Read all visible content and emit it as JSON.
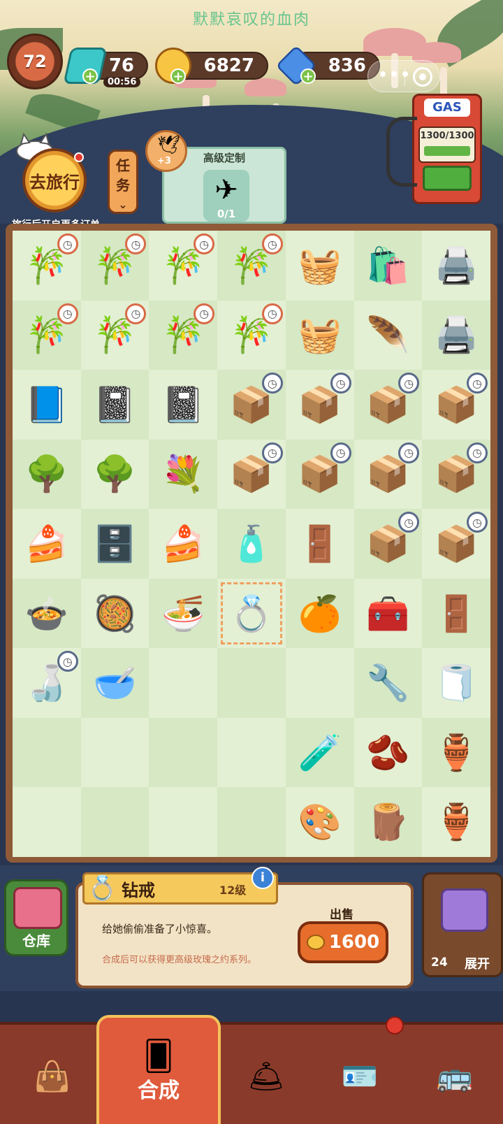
{
  "title": "默默哀叹的血肉",
  "level": "72",
  "resources": {
    "energy": {
      "value": "76",
      "timer": "00:56",
      "icon": "lightning-icon"
    },
    "coins": {
      "value": "6827",
      "icon": "paw-coin-icon"
    },
    "gems": {
      "value": "836",
      "icon": "gem-icon"
    }
  },
  "gas": {
    "sign": "GAS",
    "value": "1300/1300"
  },
  "travel": {
    "label": "去旅行",
    "tip": "旅行后开启更多订单"
  },
  "task": {
    "chars": [
      "任",
      "务"
    ]
  },
  "order": {
    "header": "高级定制",
    "count": "0/1",
    "badge": "+3"
  },
  "board": {
    "cells": [
      {
        "icon": "🎋",
        "clock": true
      },
      {
        "icon": "🎋",
        "clock": true
      },
      {
        "icon": "🎋",
        "clock": true
      },
      {
        "icon": "🎋",
        "clock": true
      },
      {
        "icon": "🧺",
        "clock": false
      },
      {
        "icon": "🛍️",
        "clock": false
      },
      {
        "icon": "🖨️",
        "clock": false
      },
      {
        "icon": "🎋",
        "clock": true
      },
      {
        "icon": "🎋",
        "clock": true
      },
      {
        "icon": "🎋",
        "clock": true
      },
      {
        "icon": "🎋",
        "clock": true
      },
      {
        "icon": "🧺",
        "clock": false
      },
      {
        "icon": "🪶",
        "clock": false
      },
      {
        "icon": "🖨️",
        "clock": false
      },
      {
        "icon": "📘",
        "clock": false
      },
      {
        "icon": "📓",
        "clock": false
      },
      {
        "icon": "📓",
        "clock": false
      },
      {
        "icon": "📦",
        "clock": true,
        "gray": true
      },
      {
        "icon": "📦",
        "clock": true,
        "gray": true
      },
      {
        "icon": "📦",
        "clock": true,
        "gray": true
      },
      {
        "icon": "📦",
        "clock": true,
        "gray": true
      },
      {
        "icon": "🌳",
        "clock": false
      },
      {
        "icon": "🌳",
        "clock": false
      },
      {
        "icon": "💐",
        "clock": false
      },
      {
        "icon": "📦",
        "clock": true,
        "gray": true
      },
      {
        "icon": "📦",
        "clock": true,
        "gray": true
      },
      {
        "icon": "📦",
        "clock": true,
        "gray": true
      },
      {
        "icon": "📦",
        "clock": true,
        "gray": true
      },
      {
        "icon": "🍰",
        "clock": false
      },
      {
        "icon": "🗄️",
        "clock": false
      },
      {
        "icon": "🍰",
        "clock": false
      },
      {
        "icon": "🧴",
        "clock": false
      },
      {
        "icon": "🚪",
        "clock": false
      },
      {
        "icon": "📦",
        "clock": true,
        "gray": true
      },
      {
        "icon": "📦",
        "clock": true,
        "gray": true
      },
      {
        "icon": "🍲",
        "clock": false
      },
      {
        "icon": "🥘",
        "clock": false
      },
      {
        "icon": "🍜",
        "clock": false
      },
      {
        "icon": "💍",
        "clock": false,
        "selected": true
      },
      {
        "icon": "🍊",
        "clock": false
      },
      {
        "icon": "🧰",
        "clock": false
      },
      {
        "icon": "🚪",
        "clock": false
      },
      {
        "icon": "🍶",
        "clock": true,
        "gray": true
      },
      {
        "icon": "🥣",
        "clock": false
      },
      {
        "icon": "",
        "clock": false
      },
      {
        "icon": "",
        "clock": false
      },
      {
        "icon": "",
        "clock": false
      },
      {
        "icon": "🔧",
        "clock": false
      },
      {
        "icon": "🧻",
        "clock": false
      },
      {
        "icon": "",
        "clock": false
      },
      {
        "icon": "",
        "clock": false
      },
      {
        "icon": "",
        "clock": false
      },
      {
        "icon": "",
        "clock": false
      },
      {
        "icon": "🧪",
        "clock": false
      },
      {
        "icon": "🫘",
        "clock": false
      },
      {
        "icon": "🏺",
        "clock": false
      },
      {
        "icon": "",
        "clock": false
      },
      {
        "icon": "",
        "clock": false
      },
      {
        "icon": "",
        "clock": false
      },
      {
        "icon": "",
        "clock": false
      },
      {
        "icon": "🎨",
        "clock": false
      },
      {
        "icon": "🪵",
        "clock": false
      },
      {
        "icon": "🏺",
        "clock": false
      }
    ]
  },
  "info": {
    "name": "钻戒",
    "level": "12级",
    "desc": "给她偷偷准备了小惊喜。",
    "hint": "合成后可以获得更高级玫瑰之约系列。",
    "sell_label": "出售",
    "sell_price": "1600",
    "store_label": "仓库",
    "expand_count": "24",
    "expand_label": "展开"
  },
  "nav": {
    "active_label": "合成"
  }
}
